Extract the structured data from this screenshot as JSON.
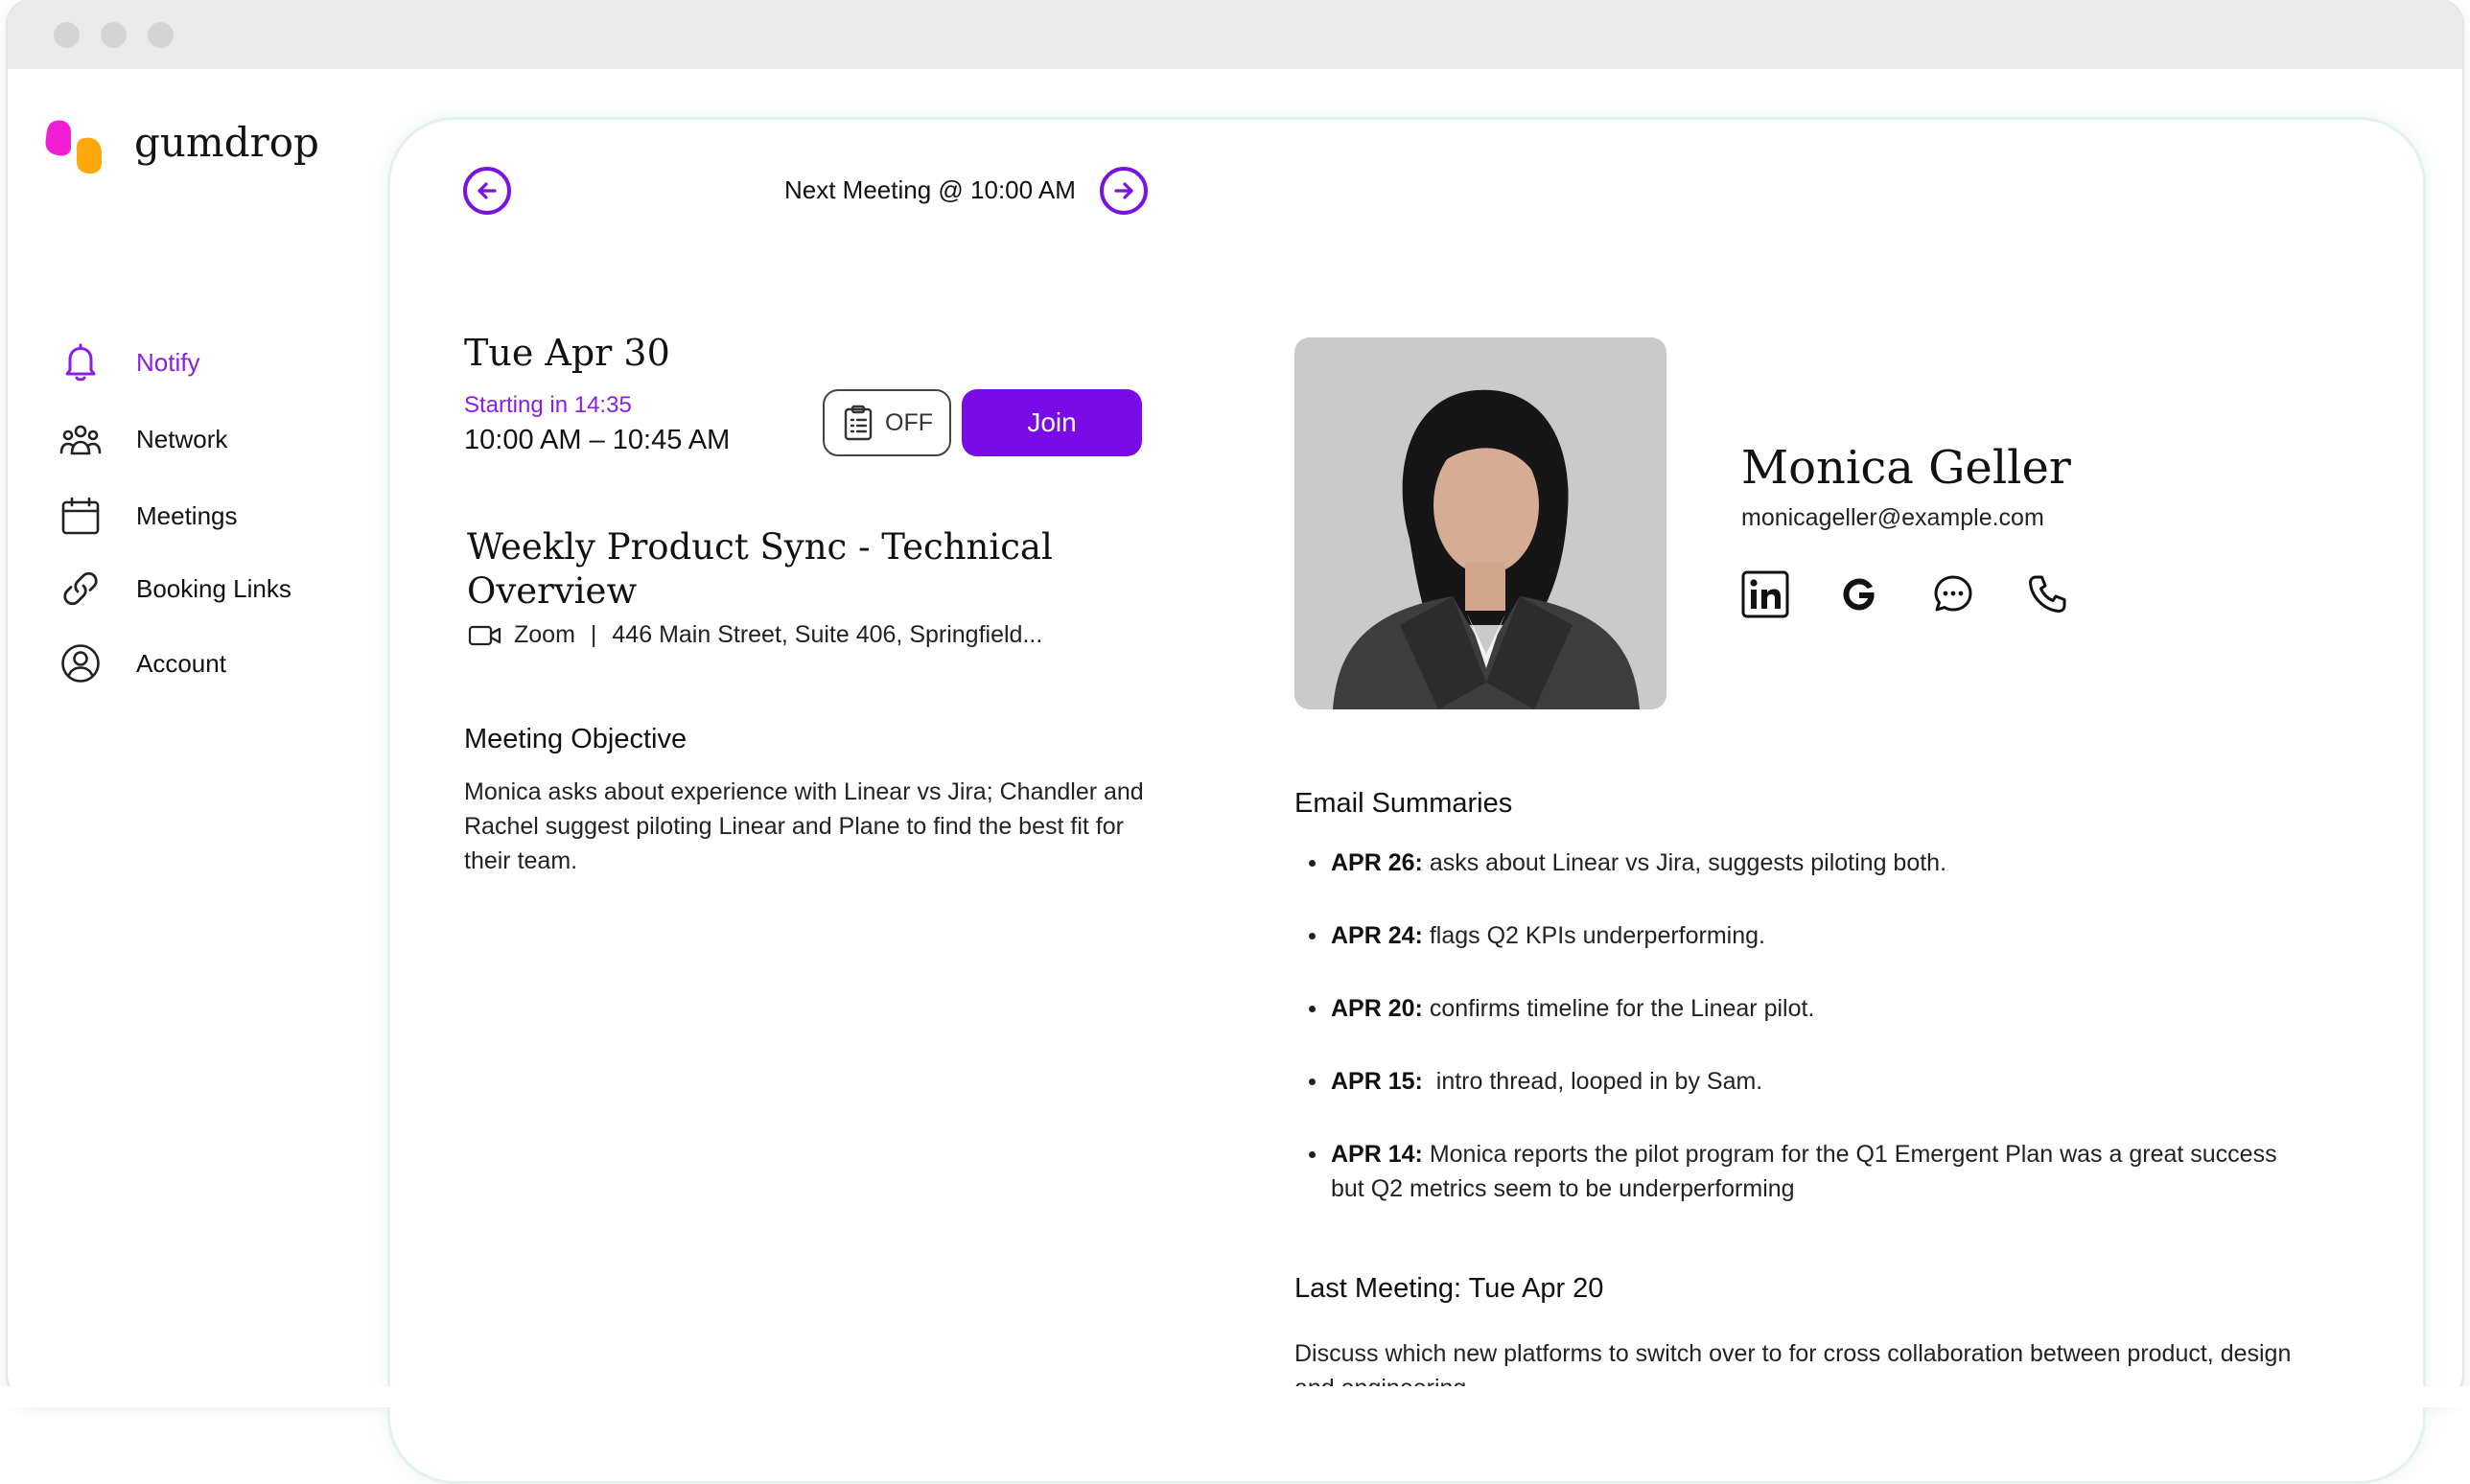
{
  "brand": {
    "name": "gumdrop",
    "colors": {
      "pink": "#f21ed6",
      "orange": "#fda90d",
      "accent": "#7a0be8"
    }
  },
  "sidebar": {
    "items": [
      {
        "label": "Notify",
        "icon": "bell-icon",
        "active": true
      },
      {
        "label": "Network",
        "icon": "people-icon",
        "active": false
      },
      {
        "label": "Meetings",
        "icon": "calendar-icon",
        "active": false
      },
      {
        "label": "Booking Links",
        "icon": "link-icon",
        "active": false
      },
      {
        "label": "Account",
        "icon": "user-circle-icon",
        "active": false
      }
    ]
  },
  "header": {
    "next_meeting": "Next Meeting @ 10:00 AM"
  },
  "meeting": {
    "date": "Tue Apr 30",
    "starting_in": "Starting in 14:35",
    "time": "10:00 AM – 10:45 AM",
    "notes_toggle": "OFF",
    "join_label": "Join",
    "title": "Weekly Product Sync - Technical Overview",
    "platform": "Zoom",
    "separator": "|",
    "address": "446 Main Street, Suite 406, Springfield...",
    "objective_heading": "Meeting Objective",
    "objective_text": "Monica asks about experience with Linear vs Jira; Chandler and Rachel suggest piloting Linear and Plane to find the best fit for their team."
  },
  "contact": {
    "name": "Monica Geller",
    "email": "monicageller@example.com",
    "social_icons": [
      "linkedin-icon",
      "google-icon",
      "chat-icon",
      "phone-icon"
    ]
  },
  "email_summaries": {
    "heading": "Email Summaries",
    "items": [
      {
        "date": "APR 26:",
        "text": " asks about Linear vs Jira, suggests piloting both."
      },
      {
        "date": "APR 24:",
        "text": " flags Q2 KPIs underperforming."
      },
      {
        "date": "APR 20:",
        "text": " confirms timeline for the Linear pilot."
      },
      {
        "date": "APR 15:",
        "text": "  intro thread, looped in by Sam."
      },
      {
        "date": "APR 14:",
        "text": " Monica reports the pilot program for the Q1 Emergent Plan was a great success but Q2 metrics seem to be underperforming"
      }
    ]
  },
  "last_meeting": {
    "heading": "Last Meeting: Tue Apr 20",
    "text": "Discuss which new platforms to switch over to for cross collaboration between product, design and engineering"
  }
}
